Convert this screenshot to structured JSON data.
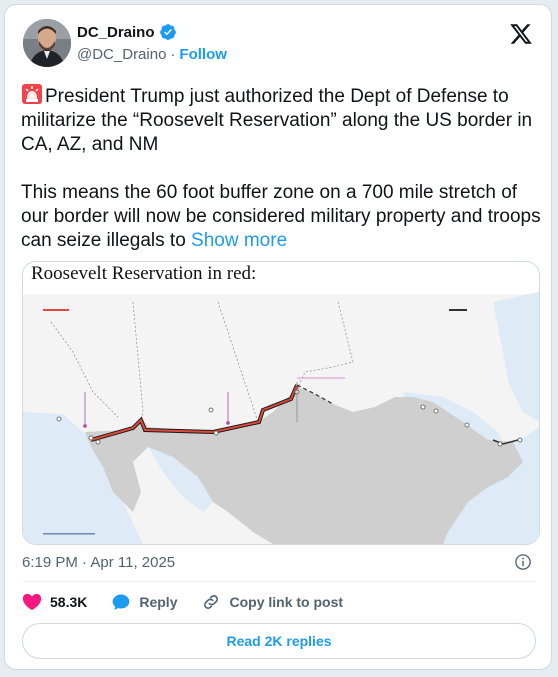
{
  "author": {
    "name": "DC_Draino",
    "handle": "@DC_Draino",
    "separator": "·",
    "follow_label": "Follow"
  },
  "post": {
    "para1": "President Trump just authorized the Dept of Defense to militarize the “Roosevelt Reservation” along the US border in CA, AZ, and NM",
    "para2": "This means the 60 foot buffer zone on a 700 mile stretch of our border will now be considered military property and troops can seize illegals to ",
    "show_more": "Show more"
  },
  "media": {
    "title": "Roosevelt Reservation in red:"
  },
  "meta": {
    "timestamp": "6:19 PM · Apr 11, 2025"
  },
  "actions": {
    "likes": "58.3K",
    "reply_label": "Reply",
    "copy_label": "Copy link to post"
  },
  "footer": {
    "read_replies": "Read 2K replies"
  },
  "colors": {
    "accent": "#1d9bf0",
    "like": "#f91880",
    "reservation_line": "#e0483a"
  }
}
